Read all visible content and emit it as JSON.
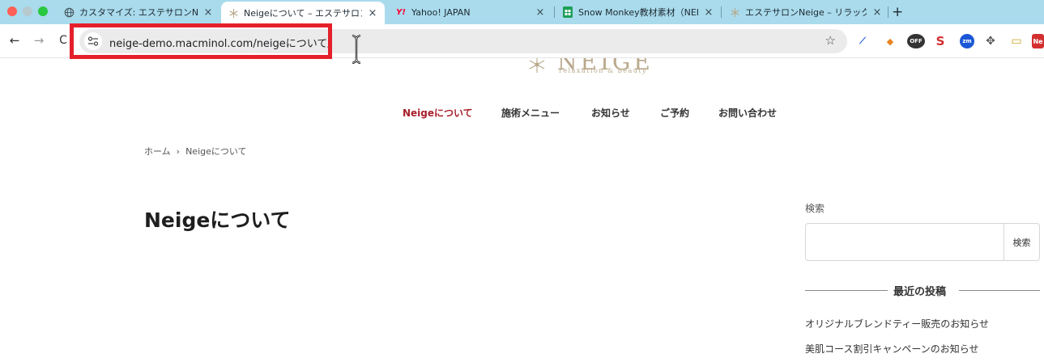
{
  "browser": {
    "tabs": [
      {
        "title": "カスタマイズ: エステサロンNEIG",
        "icon": "globe-icon"
      },
      {
        "title": "Neigeについて – エステサロンN",
        "icon": "snowflake-icon",
        "active": true
      },
      {
        "title": "Yahoo! JAPAN",
        "icon": "yahoo-icon",
        "favicon_text": "Y!"
      },
      {
        "title": "Snow Monkey教材素材（NEIG",
        "icon": "sheets-icon"
      },
      {
        "title": "エステサロンNeige – リラックス",
        "icon": "snowflake-icon"
      }
    ],
    "new_tab_label": "+",
    "close_glyph": "×",
    "back_glyph": "←",
    "forward_glyph": "→",
    "reload_glyph": "C",
    "url": "neige-demo.macminol.com/neigeについて/",
    "star_glyph": "☆",
    "extensions": [
      {
        "name": "pen-extension-icon",
        "glyph": "⟋",
        "color": "#1a56d6"
      },
      {
        "name": "fox-extension-icon",
        "glyph": "◆",
        "color": "#e8821e"
      },
      {
        "name": "adblock-off-extension-icon",
        "glyph": "OFF",
        "color": "#333333"
      },
      {
        "name": "s-extension-icon",
        "glyph": "S",
        "color": "#d32f2f"
      },
      {
        "name": "zoom-extension-icon",
        "glyph": "zm",
        "color": "#1a57d6"
      },
      {
        "name": "move-extension-icon",
        "glyph": "✥",
        "color": "#555555"
      },
      {
        "name": "card-extension-icon",
        "glyph": "▭",
        "color": "#c9a227"
      },
      {
        "name": "new-extension-icon",
        "glyph": "Ne",
        "color": "#d32f2f"
      }
    ]
  },
  "site": {
    "logo_text": "NEIGE",
    "logo_sub": "relaxation & beauty",
    "brand_color": "#b9a88b",
    "accent_color": "#a81e2b",
    "nav": [
      {
        "label": "Neigeについて",
        "current": true
      },
      {
        "label": "施術メニュー"
      },
      {
        "label": "お知らせ"
      },
      {
        "label": "ご予約"
      },
      {
        "label": "お問い合わせ"
      }
    ],
    "breadcrumb": {
      "home": "ホーム",
      "separator": "›",
      "current": "Neigeについて"
    },
    "page_title": "Neigeについて",
    "sidebar": {
      "search_label": "検索",
      "search_button": "検索",
      "search_value": "",
      "recent_title": "最近の投稿",
      "recent_posts": [
        "オリジナルブレンドティー販売のお知らせ",
        "美肌コース割引キャンペーンのお知らせ"
      ]
    }
  }
}
